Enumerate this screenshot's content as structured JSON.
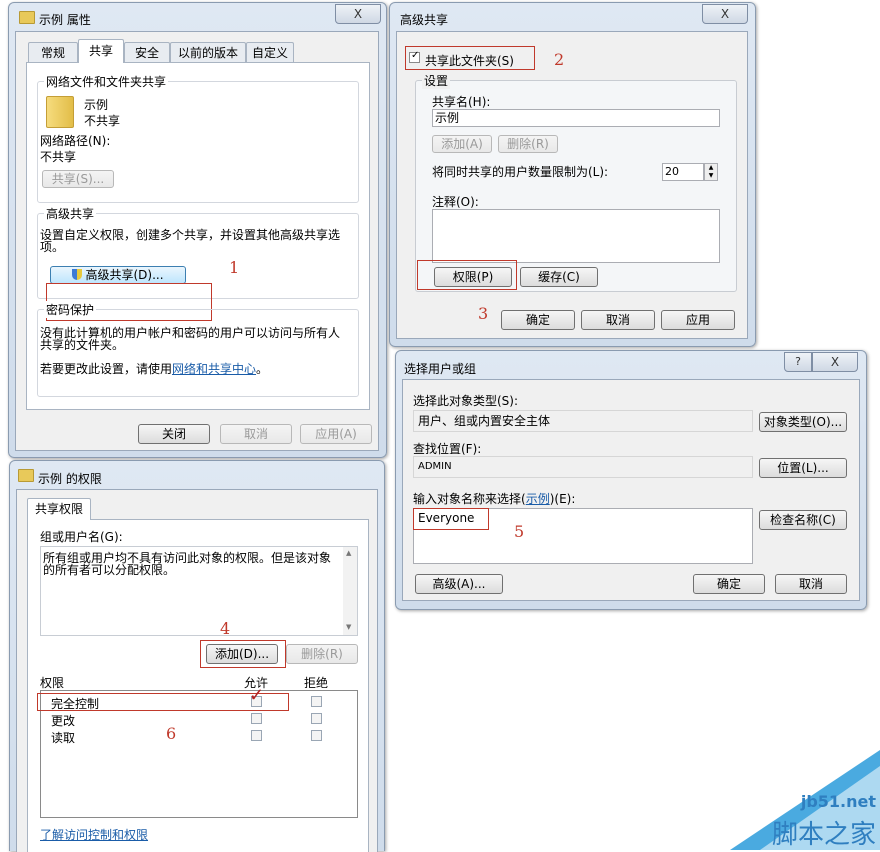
{
  "props_window": {
    "title": "示例 属性",
    "close_glyph": "X",
    "tabs": [
      "常规",
      "共享",
      "安全",
      "以前的版本",
      "自定义"
    ],
    "network_group": {
      "label": "网络文件和文件夹共享",
      "folder_name": "示例",
      "folder_status": "不共享",
      "path_label": "网络路径(N):",
      "path_value": "不共享",
      "share_button": "共享(S)..."
    },
    "advanced_group": {
      "label": "高级共享",
      "description_line1": "设置自定义权限，创建多个共享，并设置其他高级共享选",
      "description_line2": "项。",
      "button": "高级共享(D)..."
    },
    "password_group": {
      "label": "密码保护",
      "line1": "没有此计算机的用户帐户和密码的用户可以访问与所有人",
      "line2": "共享的文件夹。",
      "line3_prefix": "若要更改此设置，请使用",
      "line3_link": "网络和共享中心",
      "line3_suffix": "。"
    },
    "buttons": {
      "close": "关闭",
      "cancel": "取消",
      "apply": "应用(A)"
    }
  },
  "advanced_window": {
    "title": "高级共享",
    "close_glyph": "X",
    "share_checkbox": "共享此文件夹(S)",
    "settings_label": "设置",
    "share_name_label": "共享名(H):",
    "share_name_value": "示例",
    "add_button": "添加(A)",
    "remove_button": "删除(R)",
    "limit_label": "将同时共享的用户数量限制为(L):",
    "limit_value": "20",
    "comment_label": "注释(O):",
    "permissions_button": "权限(P)",
    "cache_button": "缓存(C)",
    "ok_button": "确定",
    "cancel_button": "取消",
    "apply_button": "应用"
  },
  "select_window": {
    "title": "选择用户或组",
    "help_glyph": "?",
    "close_glyph": "X",
    "object_type_label": "选择此对象类型(S):",
    "object_type_value": "用户、组或内置安全主体",
    "object_type_button": "对象类型(O)...",
    "location_label": "查找位置(F):",
    "location_value": "ADMIN",
    "location_button": "位置(L)...",
    "enter_label_prefix": "输入对象名称来选择(",
    "enter_label_link": "示例",
    "enter_label_suffix": ")(E):",
    "names_value": "Everyone",
    "check_names_button": "检查名称(C)",
    "advanced_button": "高级(A)...",
    "ok_button": "确定",
    "cancel_button": "取消"
  },
  "perm_window": {
    "title": "示例 的权限",
    "tab": "共享权限",
    "group_label": "组或用户名(G):",
    "info_line1": "所有组或用户均不具有访问此对象的权限。但是该对象",
    "info_line2": "的所有者可以分配权限。",
    "add_button": "添加(D)...",
    "remove_button": "删除(R)",
    "permissions_label": "权限",
    "allow_label": "允许",
    "deny_label": "拒绝",
    "rows": [
      "完全控制",
      "更改",
      "读取"
    ],
    "help_link": "了解访问控制和权限"
  },
  "annotations": [
    "1",
    "2",
    "3",
    "4",
    "5",
    "6"
  ],
  "watermark": {
    "line1": "jb51.net",
    "line2": "脚本之家"
  }
}
